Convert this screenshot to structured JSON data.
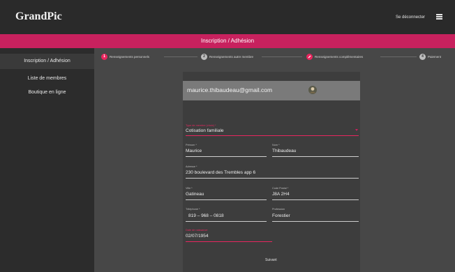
{
  "header": {
    "brand": "GrandPic",
    "logout_label": "Se déconnecter",
    "menu_icon": "hamburger-icon"
  },
  "banner": {
    "title": "Inscription / Adhésion"
  },
  "sidebar": {
    "items": [
      {
        "label": "Inscription / Adhésion",
        "active": true
      },
      {
        "label": "Liste de membres",
        "active": false
      },
      {
        "label": "Boutique en ligne",
        "active": false
      }
    ]
  },
  "stepper": {
    "steps": [
      {
        "num": "1",
        "label": "Renseignements personnels",
        "state": "error"
      },
      {
        "num": "2",
        "label": "Renseignements autre membre",
        "state": "pending"
      },
      {
        "num": "",
        "label": "Renseignements complémentaires",
        "state": "editing",
        "icon": "pencil-icon"
      },
      {
        "num": "4",
        "label": "Paiement",
        "state": "pending"
      }
    ]
  },
  "form": {
    "email": "maurice.thibaudeau@gmail.com",
    "membership_type": {
      "label": "Type de membre (choix) *",
      "value": "Cotisation familiale"
    },
    "first_name": {
      "label": "Prénom *",
      "value": "Maurice"
    },
    "last_name": {
      "label": "Nom *",
      "value": "Thibaudeau"
    },
    "address": {
      "label": "Adresse *",
      "value": "230 boulevard des Trembles app 6"
    },
    "city": {
      "label": "Ville *",
      "value": "Gatineau"
    },
    "postal_code": {
      "label": "Code Postal *",
      "value": "J8A 2H4"
    },
    "phone": {
      "label": "Téléphone *",
      "value": "819  –  968  –  0818"
    },
    "profession": {
      "label": "Profession",
      "value": "Forestier"
    },
    "birthdate": {
      "label": "Date de naissance",
      "value": "02/07/1954"
    },
    "next_label": "Suivant"
  },
  "colors": {
    "accent": "#c8215e",
    "error": "#e8265e",
    "topbar": "#2a2a2a",
    "sidebar": "#2c2c2c",
    "main": "#474747",
    "card": "#3d3d3d"
  }
}
